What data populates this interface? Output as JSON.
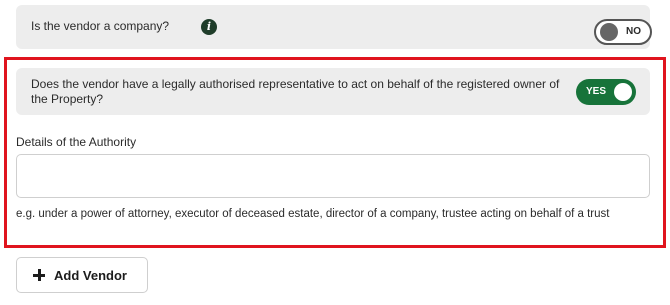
{
  "vendor_company": {
    "question": "Is the vendor a company?",
    "info_icon": "info-icon",
    "toggle_label": "NO",
    "toggle_state": "off"
  },
  "representative": {
    "question": "Does the vendor have a legally authorised representative to act on behalf of the registered owner of the Property?",
    "toggle_label": "YES",
    "toggle_state": "on",
    "toggle_color": "#17733a"
  },
  "authority": {
    "label": "Details of the Authority",
    "value": "",
    "hint": "e.g. under a power of attorney, executor of deceased estate, director of a company, trustee acting on behalf of a trust"
  },
  "add_vendor": {
    "label": "Add Vendor",
    "icon": "plus-icon"
  },
  "colors": {
    "highlight": "#e0141e",
    "row_background": "#ededed"
  }
}
